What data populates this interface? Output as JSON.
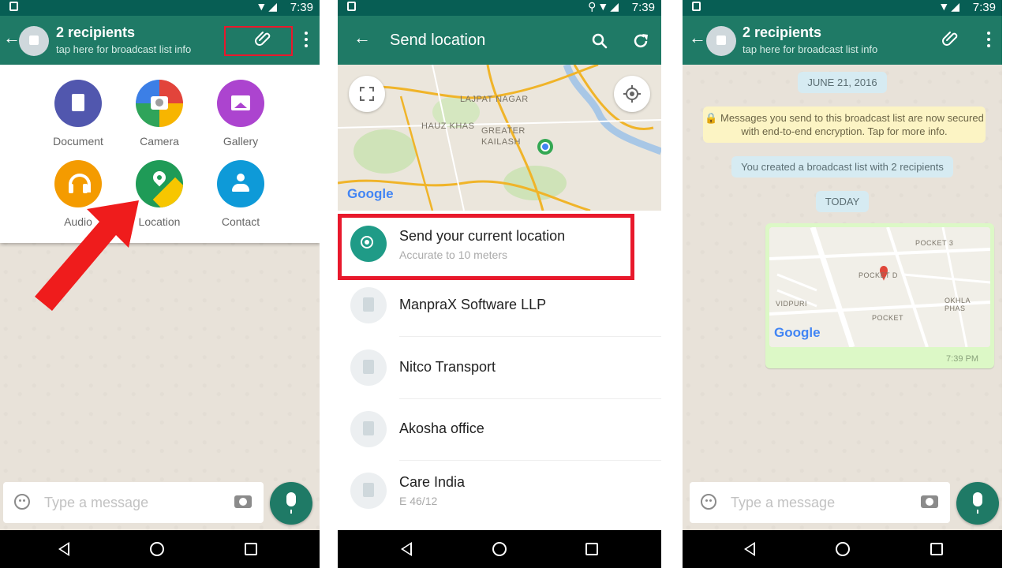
{
  "status": {
    "time": "7:39"
  },
  "broadcast": {
    "title": "2 recipients",
    "subtitle": "tap here for broadcast list info"
  },
  "attach_menu": {
    "items": [
      {
        "label": "Document",
        "icon": "document-icon",
        "color": "#5157ae"
      },
      {
        "label": "Camera",
        "icon": "camera-icon",
        "color": "#e2443b"
      },
      {
        "label": "Gallery",
        "icon": "gallery-icon",
        "color": "#ac44cf"
      },
      {
        "label": "Audio",
        "icon": "headphones-icon",
        "color": "#f49b00"
      },
      {
        "label": "Location",
        "icon": "location-pin-icon",
        "color": "#1f9b57"
      },
      {
        "label": "Contact",
        "icon": "person-icon",
        "color": "#0e9ad8"
      }
    ]
  },
  "composer": {
    "placeholder": "Type a message"
  },
  "send_location": {
    "title": "Send location",
    "map_labels": [
      "LAJPAT NAGAR",
      "HAUZ KHAS",
      "GREATER",
      "KAILASH"
    ],
    "current": {
      "name": "Send your current location",
      "detail": "Accurate to 10 meters"
    },
    "places": [
      {
        "name": "ManpraX Software LLP",
        "detail": ""
      },
      {
        "name": "Nitco Transport",
        "detail": ""
      },
      {
        "name": "Akosha office",
        "detail": ""
      },
      {
        "name": "Care India",
        "detail": "E 46/12"
      }
    ]
  },
  "chat": {
    "date_chip": "JUNE 21, 2016",
    "encryption_notice": "Messages you send to this broadcast list are now secured with end-to-end encryption. Tap for more info.",
    "created_notice": "You created a broadcast list with 2 recipients",
    "today_chip": "TODAY",
    "message_time": "7:39 PM",
    "map_labels": [
      "POCKET D",
      "POCKET 3",
      "POCKET",
      "OKHLA PHAS",
      "VIDPURI"
    ]
  },
  "brand": {
    "google": "Google"
  },
  "colors": {
    "teal": "#1f7a66",
    "dark_teal": "#075e54",
    "highlight_red": "#e8192c"
  }
}
